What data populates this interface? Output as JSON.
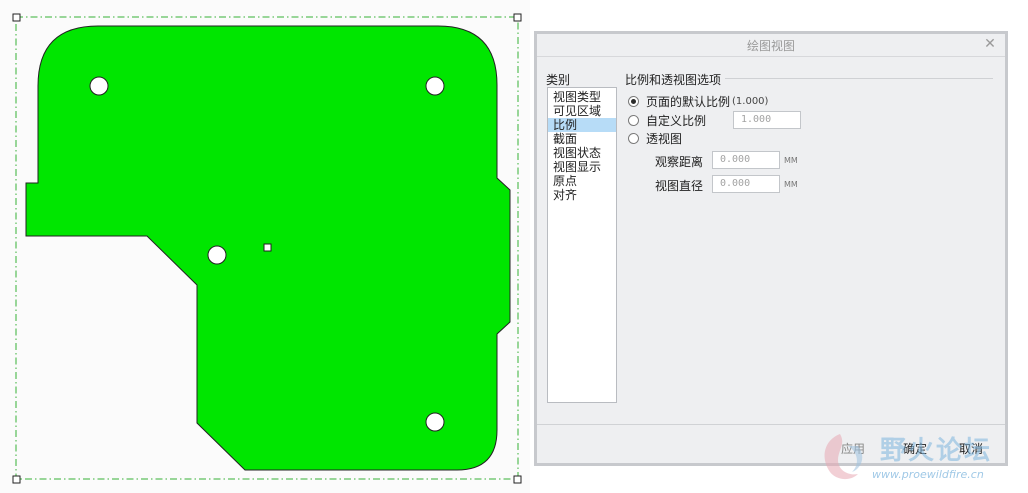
{
  "dialog": {
    "title": "绘图视图",
    "close_icon": "close-icon"
  },
  "category": {
    "label": "类别",
    "items": [
      "视图类型",
      "可见区域",
      "比例",
      "截面",
      "视图状态",
      "视图显示",
      "原点",
      "对齐"
    ],
    "selected_index": 2
  },
  "scale_section": {
    "title": "比例和透视图选项",
    "options": {
      "default_scale": {
        "label": "页面的默认比例",
        "suffix": "(1.000)",
        "checked": true
      },
      "custom_scale": {
        "label": "自定义比例",
        "value": "1.000",
        "checked": false
      },
      "perspective": {
        "label": "透视图",
        "checked": false
      }
    },
    "view_distance": {
      "label": "观察距离",
      "value": "0.000",
      "unit": "MM"
    },
    "view_diameter": {
      "label": "视图直径",
      "value": "0.000",
      "unit": "MM"
    }
  },
  "buttons": {
    "apply": "应用",
    "ok": "确定",
    "cancel": "取消"
  },
  "watermark": {
    "text": "野火论坛",
    "url": "www.proewildfire.cn"
  },
  "colors": {
    "part_fill": "#00e600",
    "selection_box": "#35b035",
    "selected_item": "#b7dcf7"
  }
}
